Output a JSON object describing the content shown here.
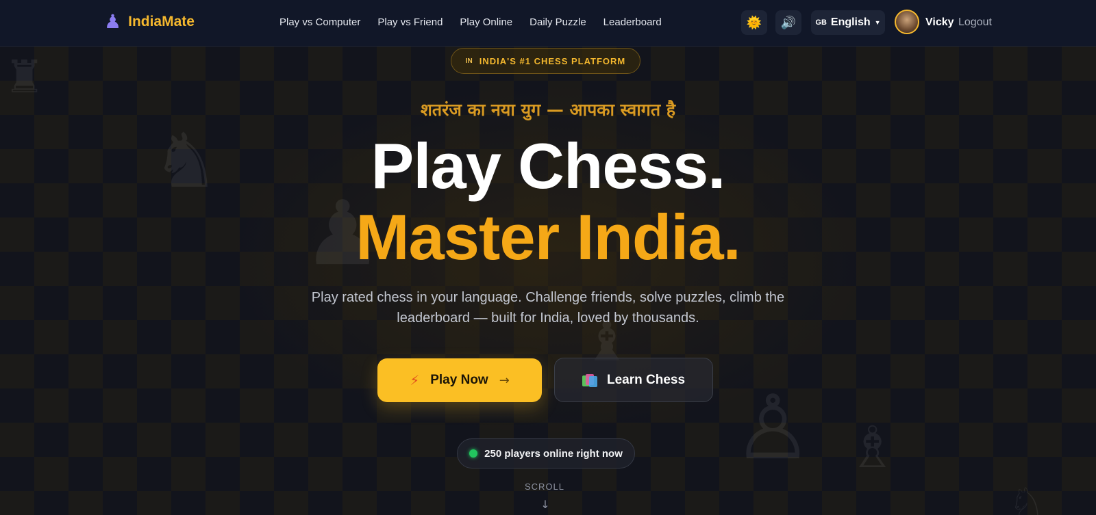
{
  "nav": {
    "brand": "IndiaMate",
    "links": [
      "Play vs Computer",
      "Play vs Friend",
      "Play Online",
      "Daily Puzzle",
      "Leaderboard"
    ],
    "language": {
      "flag": "GB",
      "label": "English"
    },
    "user": {
      "name": "Vicky",
      "logout": "Logout"
    }
  },
  "hero": {
    "badge": {
      "flag": "IN",
      "text": "INDIA'S #1 CHESS PLATFORM"
    },
    "tagline_hindi": "शतरंज का नया युग — आपका स्वागत है",
    "headline_line1": "Play Chess.",
    "headline_line2": "Master India.",
    "subtitle": "Play rated chess in your language. Challenge friends, solve puzzles, climb the leaderboard — built for India, loved by thousands.",
    "primary_button": {
      "icon": "⚡",
      "label": "Play Now",
      "arrow": "→"
    },
    "secondary_button": {
      "label": "Learn Chess"
    },
    "online_status": "250 players online right now",
    "scroll_label": "SCROLL",
    "scroll_arrow": "↓"
  },
  "icons": {
    "logo": "♟",
    "theme": "🌞",
    "sound": "🔊"
  },
  "colors": {
    "accent": "#fbbf24",
    "brand": "#f5b82e",
    "background": "#0d1220",
    "online": "#22c55e"
  }
}
